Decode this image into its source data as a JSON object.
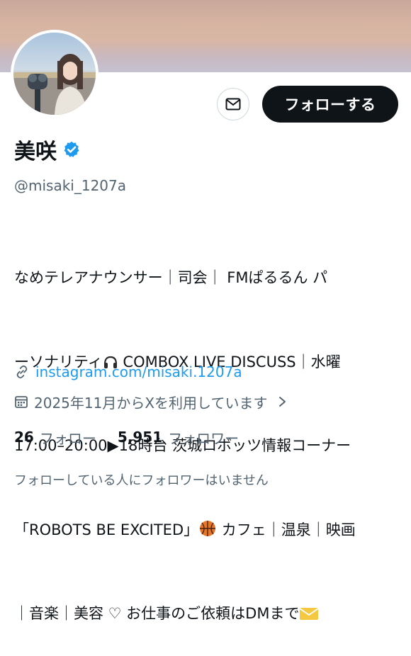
{
  "profile": {
    "display_name": "美咲",
    "verified_icon": "verified-badge-icon",
    "handle": "@misaki_1207a",
    "bio_lines": [
      "なめテレアナウンサー｜司会｜ FMぱるるん パ",
      "ーソナリティ",
      " COMBOX LIVE DISCUSS｜水曜",
      "17:00–20:00▶18時台 茨城ロボッツ情報コーナー",
      "「ROBOTS BE EXCITED」",
      " カフェ｜温泉｜映画",
      "｜音楽｜美容 ♡ お仕事のご依頼はDMまで"
    ],
    "link": "instagram.com/misaki.1207a",
    "joined": "2025年11月からXを利用しています",
    "following_count": "26",
    "following_label": "フォロー",
    "followers_count": "5,951",
    "followers_label": "フォロワー",
    "followers_you_know": "フォローしている人にフォロワーはいません"
  },
  "actions": {
    "follow_label": "フォローする",
    "message_icon": "envelope-icon"
  },
  "colors": {
    "accent_blue": "#1d9bf0",
    "text_primary": "#0f1419",
    "text_secondary": "#536471",
    "follow_button_bg": "#0f1419",
    "verified_badge": "#1d9bf0"
  },
  "icons": {
    "headphones": "headphones-icon",
    "basketball": "basketball-icon",
    "envelope_emoji": "envelope-emoji-icon",
    "link": "link-icon",
    "calendar": "calendar-icon",
    "chevron": "chevron-right-icon"
  }
}
